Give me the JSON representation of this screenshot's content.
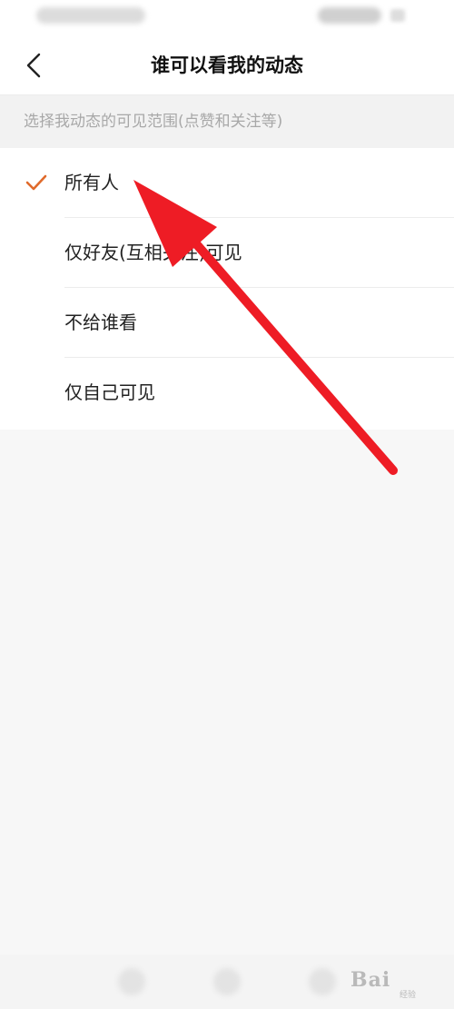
{
  "nav": {
    "title": "谁可以看我的动态",
    "back_icon": "chevron-left-icon"
  },
  "section": {
    "header": "选择我动态的可见范围(点赞和关注等)"
  },
  "options": [
    {
      "label": "所有人",
      "selected": true
    },
    {
      "label": "仅好友(互相关注)可见",
      "selected": false
    },
    {
      "label": "不给谁看",
      "selected": false
    },
    {
      "label": "仅自己可见",
      "selected": false
    }
  ],
  "colors": {
    "accent": "#e06a2b",
    "annotation": "#ee1c25",
    "title_text": "#111111",
    "secondary_text": "#a8a8a8"
  },
  "watermark": {
    "text": "Bai",
    "sub": "经验"
  }
}
